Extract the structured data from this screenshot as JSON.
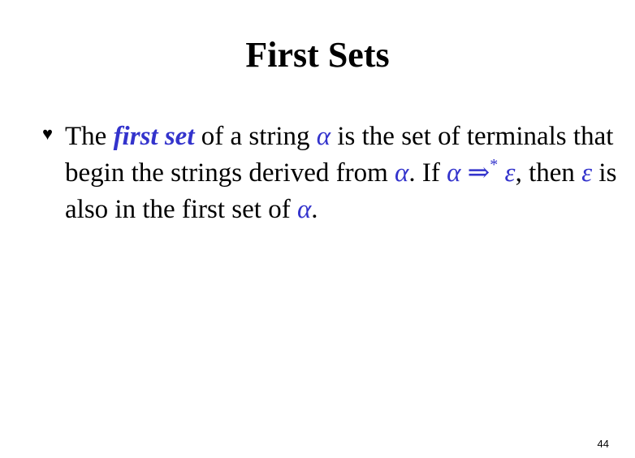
{
  "slide": {
    "title": "First Sets",
    "page_number": "44"
  },
  "bullet": {
    "icon": "heart-bullet",
    "glyph": "♥",
    "segments": {
      "t1": "The ",
      "term": "first set",
      "t2": " of a string ",
      "alpha1": "α",
      "t3": " is the set of terminals that begin the strings derived from ",
      "alpha2": "α",
      "t4": ". If ",
      "alpha3": "α",
      "derives": "⇒",
      "star": "*",
      "epsilon1": "ε",
      "t5": ", then ",
      "epsilon2": "ε",
      "t6": " is also in the first set of ",
      "alpha4": "α",
      "t7": "."
    }
  },
  "colors": {
    "accent": "#3333cc",
    "text": "#000000",
    "background": "#ffffff"
  }
}
